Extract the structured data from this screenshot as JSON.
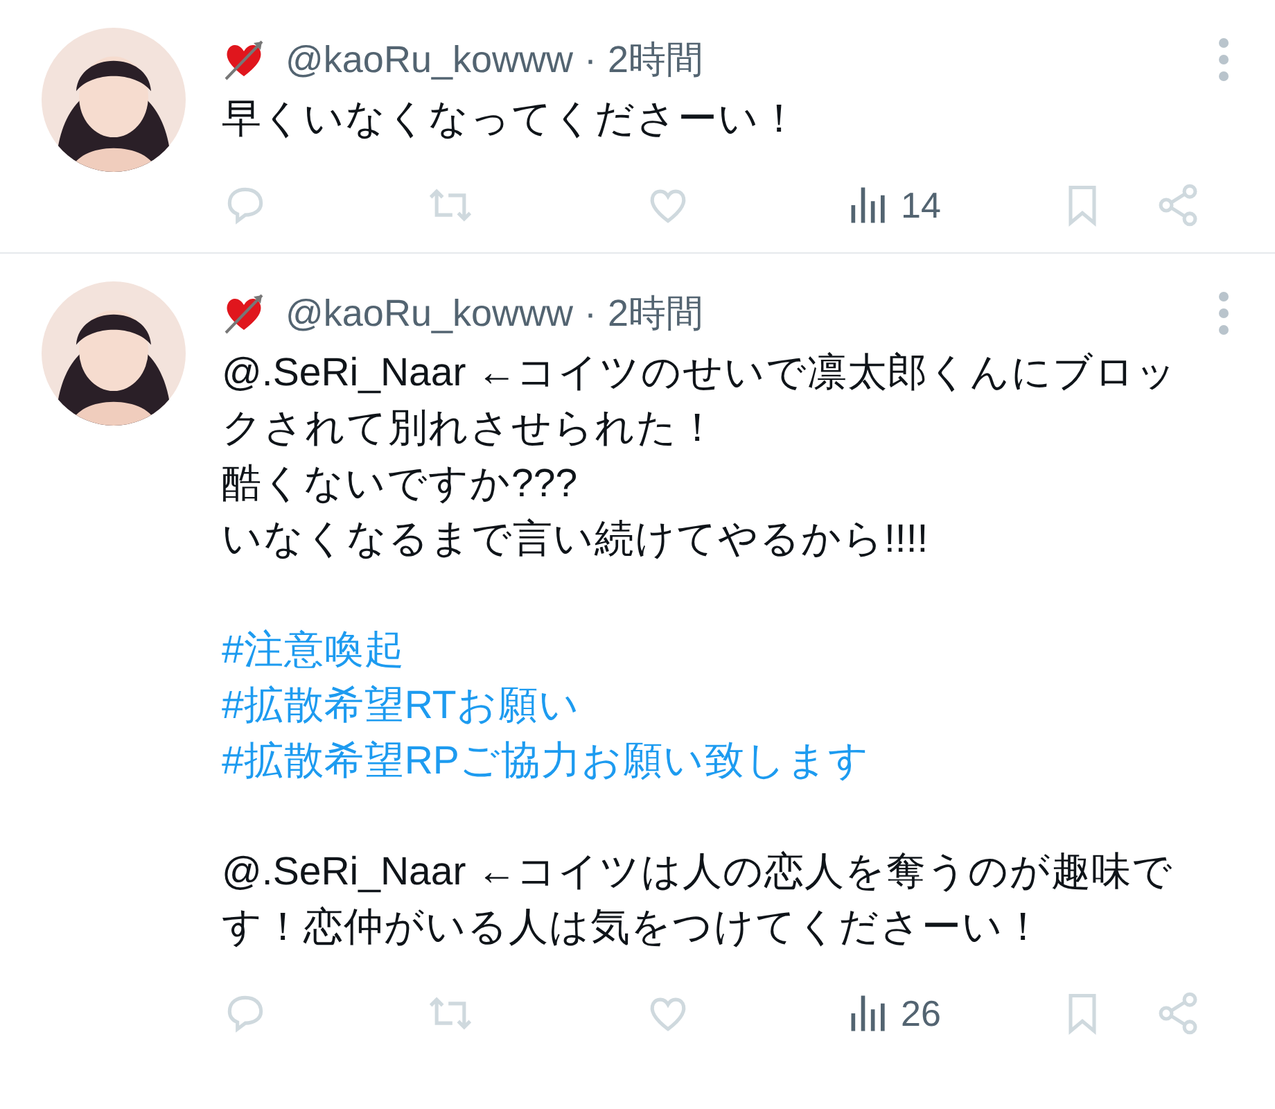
{
  "tweets": [
    {
      "handle": "@kaoRu_kowww",
      "separator": "·",
      "time": "2時間",
      "views": "14",
      "paragraphs": [
        [
          {
            "kind": "text",
            "text": "早くいなくなってくださーい！"
          }
        ]
      ]
    },
    {
      "handle": "@kaoRu_kowww",
      "separator": "·",
      "time": "2時間",
      "views": "26",
      "paragraphs": [
        [
          {
            "kind": "text",
            "text": "@.SeRi_Naar ←コイツのせいで凛太郎くんにブロックされて別れさせられた！"
          },
          {
            "kind": "text",
            "text": "酷くないですか???"
          },
          {
            "kind": "text",
            "text": "いなくなるまで言い続けてやるから!!!!"
          }
        ],
        [
          {
            "kind": "hashtag",
            "text": "#注意喚起"
          },
          {
            "kind": "hashtag",
            "text": "#拡散希望RTお願い"
          },
          {
            "kind": "hashtag",
            "text": "#拡散希望RPご協力お願い致します"
          }
        ],
        [
          {
            "kind": "text",
            "text": "@.SeRi_Naar ←コイツは人の恋人を奪うのが趣味です！恋仲がいる人は気をつけてくださーい！"
          }
        ]
      ]
    }
  ]
}
